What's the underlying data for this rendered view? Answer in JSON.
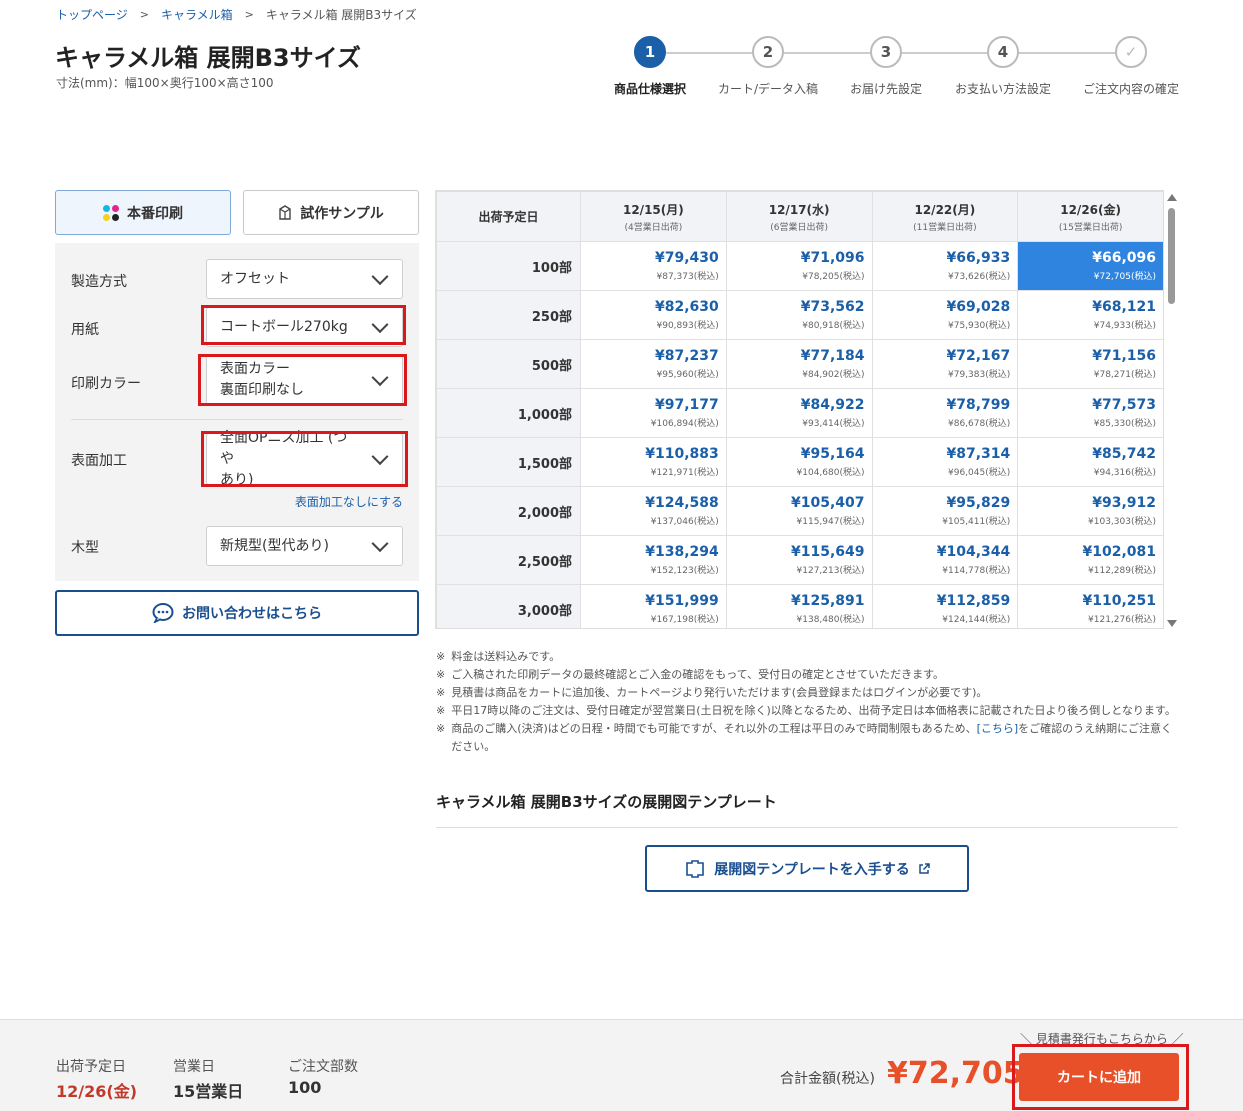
{
  "breadcrumb": [
    "トップページ",
    "キャラメル箱",
    "キャラメル箱 展開B3サイズ"
  ],
  "title": "キャラメル箱 展開B3サイズ",
  "subtitle": "寸法(mm)：幅100×奥行100×高さ100",
  "steps": [
    {
      "num": "1",
      "label": "商品仕様選択"
    },
    {
      "num": "2",
      "label": "カート/データ入稿"
    },
    {
      "num": "3",
      "label": "お届け先設定"
    },
    {
      "num": "4",
      "label": "お支払い方法設定"
    },
    {
      "num": "✓",
      "label": "ご注文内容の確定"
    }
  ],
  "tabs": {
    "production": "本番印刷",
    "sample": "試作サンプル"
  },
  "dot_colors": [
    "#1ab5e8",
    "#e8248c",
    "#f2d21a",
    "#222222"
  ],
  "specs": {
    "method": {
      "label": "製造方式",
      "value": "オフセット"
    },
    "paper": {
      "label": "用紙",
      "value": "コートボール270kg"
    },
    "color": {
      "label": "印刷カラー",
      "value1": "表面カラー",
      "value2": "裏面印刷なし"
    },
    "finish": {
      "label": "表面加工",
      "value1": "全面OPニス加工 (つや",
      "value2": "あり)",
      "link": "表面加工なしにする"
    },
    "die": {
      "label": "木型",
      "value": "新規型(型代あり)"
    }
  },
  "contact_button": "お問い合わせはこちら",
  "table": {
    "corner": "出荷予定日",
    "dates": [
      {
        "date": "12/15(月)",
        "sub": "(4営業日出荷)"
      },
      {
        "date": "12/17(水)",
        "sub": "(6営業日出荷)"
      },
      {
        "date": "12/22(月)",
        "sub": "(11営業日出荷)"
      },
      {
        "date": "12/26(金)",
        "sub": "(15営業日出荷)"
      }
    ],
    "rows": [
      {
        "qty": "100部",
        "prices": [
          [
            "¥79,430",
            "¥87,373(税込)"
          ],
          [
            "¥71,096",
            "¥78,205(税込)"
          ],
          [
            "¥66,933",
            "¥73,626(税込)"
          ],
          [
            "¥66,096",
            "¥72,705(税込)"
          ]
        ]
      },
      {
        "qty": "250部",
        "prices": [
          [
            "¥82,630",
            "¥90,893(税込)"
          ],
          [
            "¥73,562",
            "¥80,918(税込)"
          ],
          [
            "¥69,028",
            "¥75,930(税込)"
          ],
          [
            "¥68,121",
            "¥74,933(税込)"
          ]
        ]
      },
      {
        "qty": "500部",
        "prices": [
          [
            "¥87,237",
            "¥95,960(税込)"
          ],
          [
            "¥77,184",
            "¥84,902(税込)"
          ],
          [
            "¥72,167",
            "¥79,383(税込)"
          ],
          [
            "¥71,156",
            "¥78,271(税込)"
          ]
        ]
      },
      {
        "qty": "1,000部",
        "prices": [
          [
            "¥97,177",
            "¥106,894(税込)"
          ],
          [
            "¥84,922",
            "¥93,414(税込)"
          ],
          [
            "¥78,799",
            "¥86,678(税込)"
          ],
          [
            "¥77,573",
            "¥85,330(税込)"
          ]
        ]
      },
      {
        "qty": "1,500部",
        "prices": [
          [
            "¥110,883",
            "¥121,971(税込)"
          ],
          [
            "¥95,164",
            "¥104,680(税込)"
          ],
          [
            "¥87,314",
            "¥96,045(税込)"
          ],
          [
            "¥85,742",
            "¥94,316(税込)"
          ]
        ]
      },
      {
        "qty": "2,000部",
        "prices": [
          [
            "¥124,588",
            "¥137,046(税込)"
          ],
          [
            "¥105,407",
            "¥115,947(税込)"
          ],
          [
            "¥95,829",
            "¥105,411(税込)"
          ],
          [
            "¥93,912",
            "¥103,303(税込)"
          ]
        ]
      },
      {
        "qty": "2,500部",
        "prices": [
          [
            "¥138,294",
            "¥152,123(税込)"
          ],
          [
            "¥115,649",
            "¥127,213(税込)"
          ],
          [
            "¥104,344",
            "¥114,778(税込)"
          ],
          [
            "¥102,081",
            "¥112,289(税込)"
          ]
        ]
      },
      {
        "qty": "3,000部",
        "prices": [
          [
            "¥151,999",
            "¥167,198(税込)"
          ],
          [
            "¥125,891",
            "¥138,480(税込)"
          ],
          [
            "¥112,859",
            "¥124,144(税込)"
          ],
          [
            "¥110,251",
            "¥121,276(税込)"
          ]
        ]
      }
    ],
    "selected": {
      "row": 0,
      "col": 3
    }
  },
  "notes": {
    "n1": "料金は送料込みです。",
    "n2": "ご入稿された印刷データの最終確認とご入金の確認をもって、受付日の確定とさせていただきます。",
    "n3": "見積書は商品をカートに追加後、カートページより発行いただけます(会員登録またはログインが必要です)。",
    "n4": "平日17時以降のご注文は、受付日確定が翌営業日(土日祝を除く)以降となるため、出荷予定日は本価格表に記載された日より後ろ倒しとなります。",
    "n5a": "商品のご購入(決済)はどの日程・時間でも可能ですが、それ以外の工程は平日のみで時間制限もあるため、",
    "n5link": "[こちら]",
    "n5b": "をご確認のうえ納期にご注意ください。"
  },
  "template": {
    "title": "キャラメル箱 展開B3サイズの展開図テンプレート",
    "button": "展開図テンプレートを入手する"
  },
  "summary": {
    "ship_label": "出荷予定日",
    "ship_value": "12/26(金)",
    "days_label": "営業日",
    "days_value": "15営業日",
    "qty_label": "ご注文部数",
    "qty_value": "100",
    "total_label": "合計金額(税込)",
    "total_value": "¥72,705",
    "estimate_note": "＼ 見積書発行もこちらから ／",
    "cart_button": "カートに追加"
  }
}
